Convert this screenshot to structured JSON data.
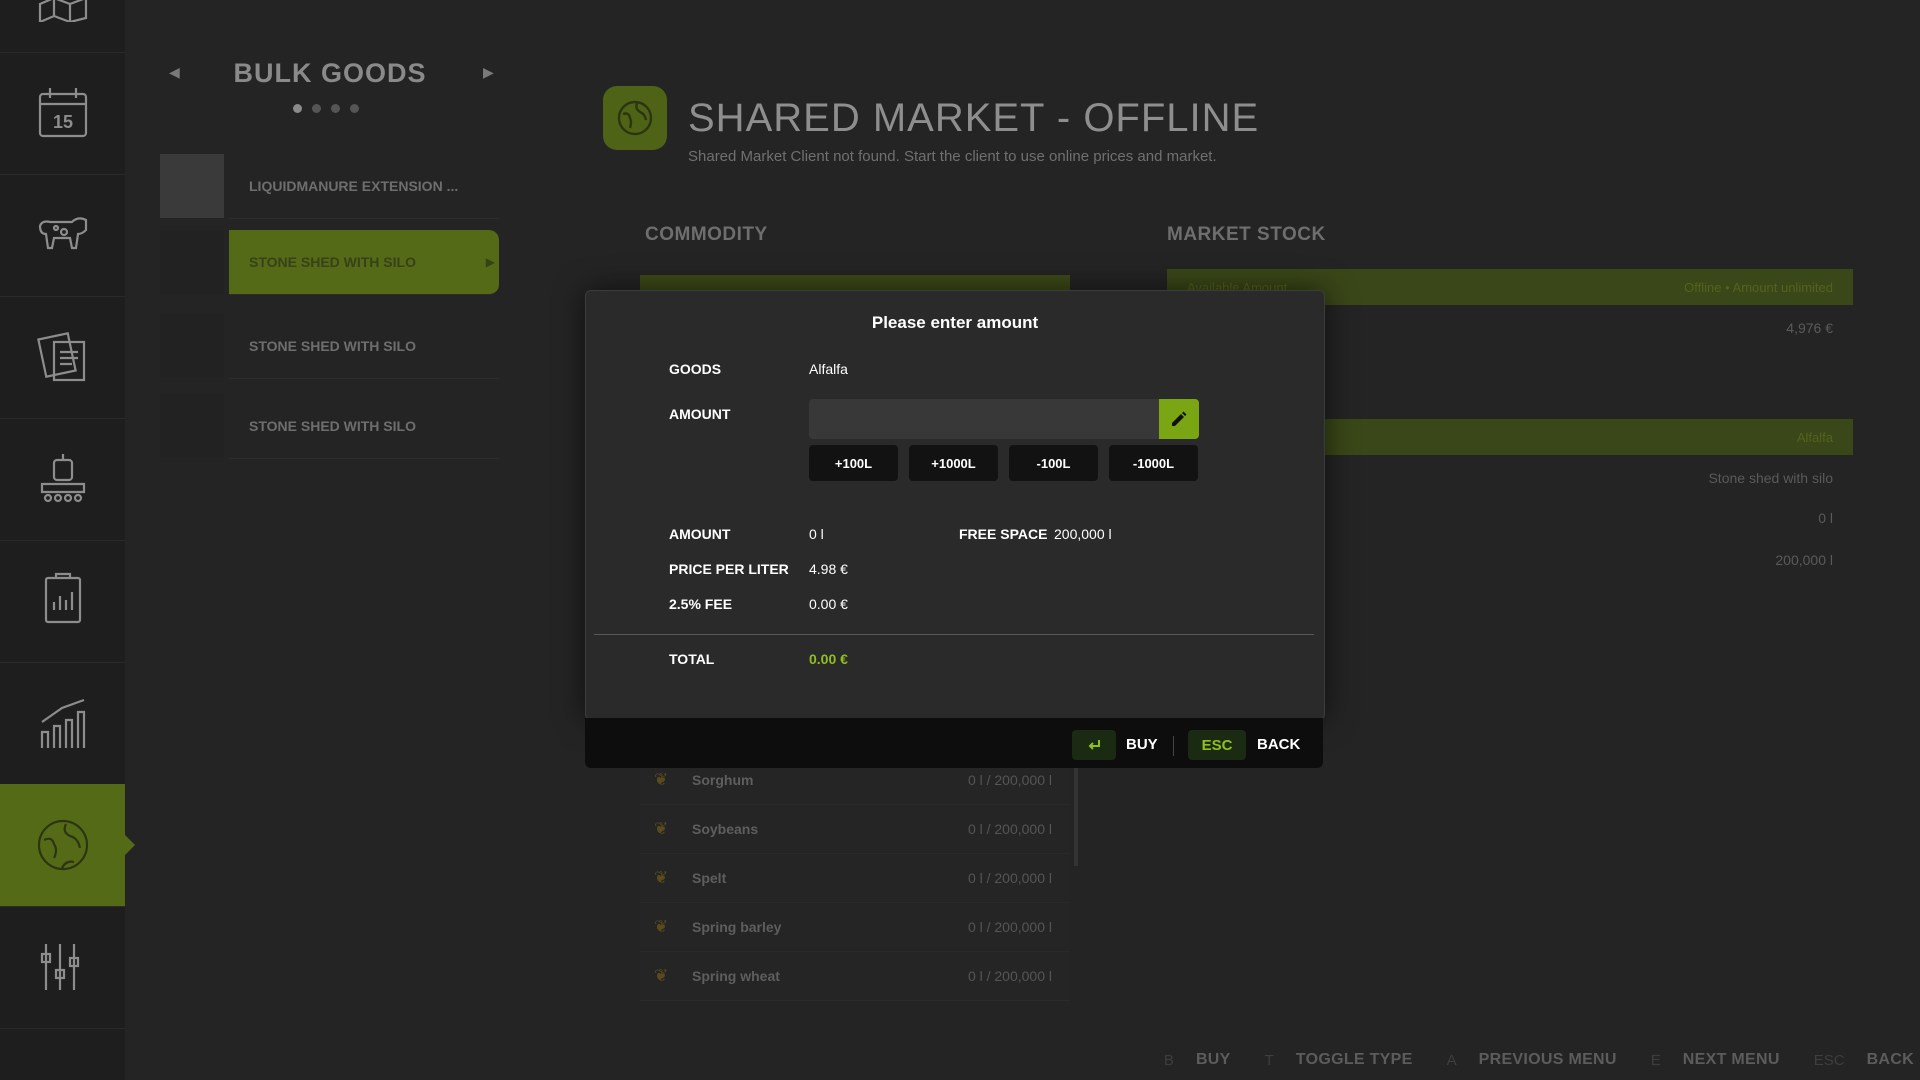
{
  "rail": {
    "items": [
      {
        "name": "map-icon"
      },
      {
        "name": "calendar-icon",
        "label": "15"
      },
      {
        "name": "animals-icon"
      },
      {
        "name": "contracts-icon"
      },
      {
        "name": "production-icon"
      },
      {
        "name": "field-tracker-icon"
      },
      {
        "name": "statistics-icon"
      },
      {
        "name": "shared-market-icon",
        "active": true
      },
      {
        "name": "settings-icon"
      }
    ]
  },
  "category_panel": {
    "title": "BULK GOODS",
    "page_dots": 4,
    "active_dot": 0,
    "items": [
      {
        "label": "LIQUIDMANURE EXTENSION ..."
      },
      {
        "label": "STONE SHED WITH SILO",
        "selected": true
      },
      {
        "label": "STONE SHED WITH SILO"
      },
      {
        "label": "STONE SHED WITH SILO"
      }
    ]
  },
  "header": {
    "title": "SHARED MARKET - OFFLINE",
    "subtitle": "Shared Market Client not found. Start the client to use online prices and market."
  },
  "sections": {
    "commodity": "COMMODITY",
    "market_stock": "MARKET STOCK"
  },
  "market_stock": {
    "bar1_left": "Available Amount",
    "bar1_right": "Offline • Amount unlimited",
    "row1": "4,976 €",
    "bar2_right": "Alfalfa",
    "row2": "Stone shed with silo",
    "row3": "0 l",
    "row4": "200,000 l"
  },
  "commodities": [
    {
      "name": "Sorghum",
      "value": "0 l / 200,000 l"
    },
    {
      "name": "Soybeans",
      "value": "0 l / 200,000 l"
    },
    {
      "name": "Spelt",
      "value": "0 l / 200,000 l"
    },
    {
      "name": "Spring barley",
      "value": "0 l / 200,000 l"
    },
    {
      "name": "Spring wheat",
      "value": "0 l / 200,000 l"
    }
  ],
  "dialog": {
    "title": "Please enter amount",
    "goods_label": "GOODS",
    "goods_value": "Alfalfa",
    "amount_input_label": "AMOUNT",
    "amount_input_value": "",
    "steps": [
      "+100L",
      "+1000L",
      "-100L",
      "-1000L"
    ],
    "amount_label": "AMOUNT",
    "amount_value": "0 l",
    "free_space_label": "FREE SPACE",
    "free_space_value": "200,000 l",
    "price_label": "PRICE PER LITER",
    "price_value": "4.98 €",
    "fee_label": "2.5% FEE",
    "fee_value": "0.00 €",
    "total_label": "TOTAL",
    "total_value": "0.00 €",
    "footer": {
      "buy_label": "BUY",
      "esc_key": "ESC",
      "back_label": "BACK"
    }
  },
  "help_bar": [
    {
      "key": "B",
      "label": "BUY"
    },
    {
      "key": "T",
      "label": "TOGGLE TYPE"
    },
    {
      "key": "A",
      "label": "PREVIOUS MENU"
    },
    {
      "key": "E",
      "label": "NEXT MENU"
    },
    {
      "key": "ESC",
      "label": "BACK"
    }
  ],
  "colors": {
    "accent": "#7ba614",
    "accent_dim": "#556a16",
    "total_green": "#8fbf1f",
    "background": "#242424"
  }
}
